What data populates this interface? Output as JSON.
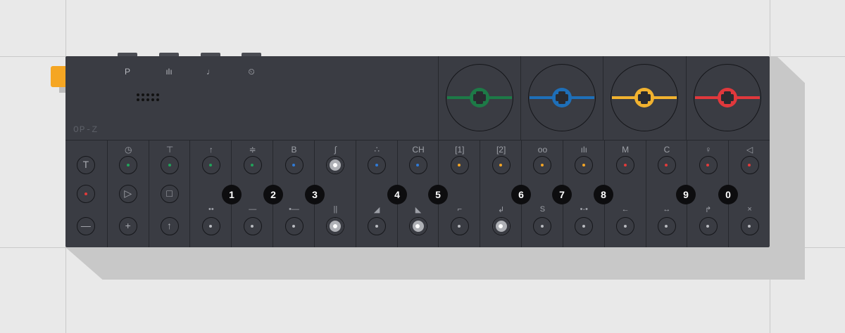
{
  "device": {
    "logo": "OP-Z",
    "display_icons": [
      "P",
      "ılı",
      "♩",
      "⏲"
    ]
  },
  "encoders": [
    {
      "name": "green-encoder",
      "color": "#1d7a47"
    },
    {
      "name": "blue-encoder",
      "color": "#1e6fb8"
    },
    {
      "name": "yellow-encoder",
      "color": "#f1b22f"
    },
    {
      "name": "red-encoder",
      "color": "#e0383c"
    }
  ],
  "columns": [
    {
      "label": "",
      "top": "T",
      "mid": "rec-red",
      "bottom": "—",
      "mid_label": ""
    },
    {
      "label": "◷",
      "top": "green",
      "mid": "▷",
      "bottom": "+",
      "mid_label": ""
    },
    {
      "label": "⊤",
      "top": "green",
      "mid": "□",
      "bottom": "↑",
      "mid_label": ""
    },
    {
      "label": "↑",
      "top": "green",
      "mid": "",
      "bottom": "dot",
      "mid_label": "••"
    },
    {
      "label": "≑",
      "top": "green",
      "mid": "",
      "bottom": "dot",
      "mid_label": "—"
    },
    {
      "label": "B",
      "top": "blue",
      "mid": "",
      "bottom": "dot",
      "mid_label": "•—"
    },
    {
      "label": "∫",
      "top": "lit",
      "mid": "",
      "bottom": "lit",
      "mid_label": "||"
    },
    {
      "label": "∴",
      "top": "blue",
      "mid": "",
      "bottom": "dot",
      "mid_label": "◢"
    },
    {
      "label": "CH",
      "top": "blue",
      "mid": "",
      "bottom": "lit",
      "mid_label": "◣"
    },
    {
      "label": "[1]",
      "top": "orange",
      "mid": "",
      "bottom": "dot",
      "mid_label": "⌐"
    },
    {
      "label": "[2]",
      "top": "orange",
      "mid": "",
      "bottom": "lit",
      "mid_label": "↲"
    },
    {
      "label": "oo",
      "top": "orange",
      "mid": "",
      "bottom": "dot",
      "mid_label": "S"
    },
    {
      "label": "ılı",
      "top": "orange",
      "mid": "",
      "bottom": "dot",
      "mid_label": "•-•"
    },
    {
      "label": "M",
      "top": "red",
      "mid": "",
      "bottom": "dot",
      "mid_label": "←"
    },
    {
      "label": "C",
      "top": "red",
      "mid": "",
      "bottom": "dot",
      "mid_label": "↔"
    },
    {
      "label": "♀",
      "top": "red",
      "mid": "",
      "bottom": "dot",
      "mid_label": "↱"
    },
    {
      "label": "◁",
      "top": "red",
      "mid": "",
      "bottom": "dot",
      "mid_label": "×"
    }
  ],
  "numbers": [
    "1",
    "2",
    "3",
    "4",
    "5",
    "6",
    "7",
    "8",
    "9",
    "0"
  ],
  "colors": {
    "green": "#22a25a",
    "blue": "#2f7ad6",
    "orange": "#f2a425",
    "red": "#e23a3a",
    "body": "#3a3c43",
    "accent_tab": "#f5a623"
  }
}
